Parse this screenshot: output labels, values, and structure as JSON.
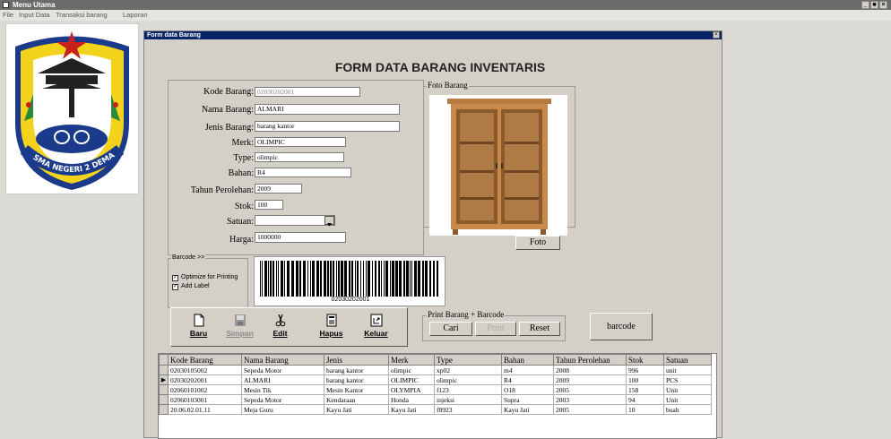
{
  "window": {
    "title": "Menu Utama",
    "min_label": "_",
    "max_label": "■",
    "close_label": "×"
  },
  "menu": [
    "File",
    "Input Data",
    "Transaksi barang",
    "Laporan"
  ],
  "logo": {
    "text": "SMA NEGERI 2 DEMAK"
  },
  "form": {
    "title": "Form data Barang",
    "close_label": "×",
    "heading": "FORM DATA BARANG INVENTARIS",
    "labels": {
      "kode": "Kode Barang:",
      "nama": "Nama Barang:",
      "jenis": "Jenis Barang:",
      "merk": "Merk:",
      "type": "Type:",
      "bahan": "Bahan:",
      "tahun": "Tahun Perolehan:",
      "stok": "Stok:",
      "satuan": "Satuan:",
      "harga": "Harga:"
    },
    "values": {
      "kode": "02030202001",
      "nama": "ALMARI",
      "jenis": "barang kantor",
      "merk": "OLIMPIC",
      "type": "olimpic",
      "bahan": "R4",
      "tahun": "2009",
      "stok": "100",
      "satuan": "",
      "harga": "1000000"
    },
    "foto": {
      "group_label": "Foto Barang",
      "button": "Foto"
    },
    "barcode": {
      "group_label": "Barcode >>",
      "opt_print": "Optimize for Printing",
      "opt_label": "Add Label",
      "value": "02030202001"
    },
    "toolbar": {
      "baru": "Baru",
      "simpan": "Simpan",
      "edit": "Edit",
      "hapus": "Hapus",
      "keluar": "Keluar"
    },
    "print_group": {
      "label": "Print Barang + Barcode",
      "cari": "Cari",
      "print": "Print",
      "reset": "Reset"
    },
    "barcode_button": "barcode"
  },
  "table": {
    "columns": [
      "Kode Barang",
      "Nama Barang",
      "Jenis",
      "Merk",
      "Type",
      "Bahan",
      "Tahun Perolehan",
      "Stok",
      "Satuan"
    ],
    "rows": [
      [
        "02030105002",
        "Sepeda Motor",
        "barang kantor",
        "olimpic",
        "xp02",
        "m4",
        "2008",
        "996",
        "unit"
      ],
      [
        "02030202001",
        "ALMARI",
        "barang kantor",
        "OLIMPIC",
        "olimpic",
        "R4",
        "2009",
        "100",
        "PCS"
      ],
      [
        "02060101002",
        "Mesin Tik",
        "Mesin Kantor",
        "OLYMPIA",
        "f123",
        "O18",
        "2005",
        "158",
        "Unit"
      ],
      [
        "02060103001",
        "Sepeda Motor",
        "Kendaraan",
        "Honda",
        "injeksi",
        "Supra",
        "2003",
        "94",
        "Unit"
      ],
      [
        "20.06.02.01.11",
        "Meja Guru",
        "Kayu Jati",
        "Kayu Jati",
        "f8923",
        "Kayu Jati",
        "2005",
        "10",
        "buah"
      ]
    ],
    "selected_row": 1
  },
  "colors": {
    "form_title": "#0a246a",
    "app_titlebar": "#6b6b6b",
    "logo_yellow": "#f2d21b",
    "logo_blue": "#1b3a8c"
  }
}
